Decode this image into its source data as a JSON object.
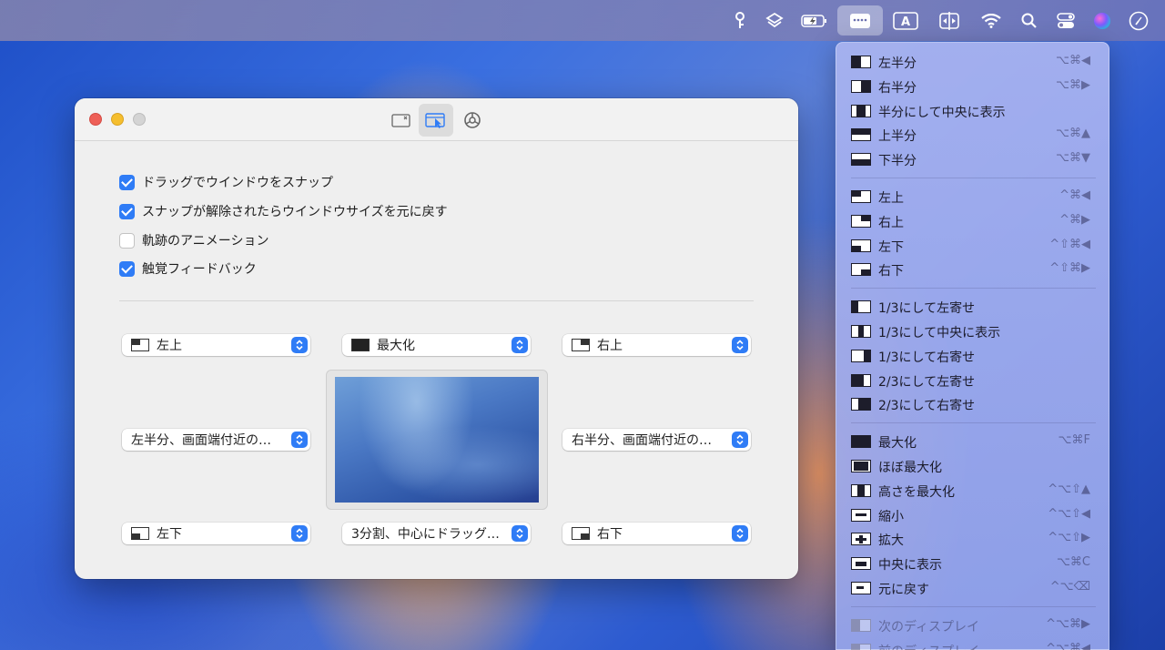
{
  "menubar": {
    "items": [
      {
        "name": "key-icon",
        "glyph": "⚿"
      },
      {
        "name": "layers-icon",
        "glyph": "◈"
      },
      {
        "name": "battery-icon",
        "glyph": ""
      },
      {
        "name": "window-manager-icon",
        "glyph": ""
      },
      {
        "name": "input-source-icon",
        "glyph": "A"
      },
      {
        "name": "split-view-icon",
        "glyph": ""
      },
      {
        "name": "wifi-icon",
        "glyph": ""
      },
      {
        "name": "search-icon",
        "glyph": ""
      },
      {
        "name": "control-center-icon",
        "glyph": ""
      },
      {
        "name": "siri-icon",
        "glyph": ""
      },
      {
        "name": "clock-icon",
        "glyph": ""
      }
    ]
  },
  "window": {
    "checkboxes": [
      {
        "label": "ドラッグでウインドウをスナップ",
        "checked": true
      },
      {
        "label": "スナップが解除されたらウインドウサイズを元に戻す",
        "checked": true
      },
      {
        "label": "軌跡のアニメーション",
        "checked": false
      },
      {
        "label": "触覚フィードバック",
        "checked": true
      }
    ],
    "selects": {
      "top_left": "左上",
      "top_center": "最大化",
      "top_right": "右上",
      "middle_left": "左半分、画面端付近の…",
      "middle_right": "右半分、画面端付近の…",
      "bottom_left": "左下",
      "bottom_center": "3分割、中心にドラッグ…",
      "bottom_right": "右下"
    }
  },
  "menu": {
    "groups": [
      [
        {
          "label": "左半分",
          "shortcut": "⌥⌘◀",
          "icon": "left-half"
        },
        {
          "label": "右半分",
          "shortcut": "⌥⌘▶",
          "icon": "right-half"
        },
        {
          "label": "半分にして中央に表示",
          "shortcut": "",
          "icon": "center-half"
        },
        {
          "label": "上半分",
          "shortcut": "⌥⌘▲",
          "icon": "top-half"
        },
        {
          "label": "下半分",
          "shortcut": "⌥⌘▼",
          "icon": "bottom-half"
        }
      ],
      [
        {
          "label": "左上",
          "shortcut": "^⌘◀",
          "icon": "top-left"
        },
        {
          "label": "右上",
          "shortcut": "^⌘▶",
          "icon": "top-right"
        },
        {
          "label": "左下",
          "shortcut": "^⇧⌘◀",
          "icon": "bottom-left"
        },
        {
          "label": "右下",
          "shortcut": "^⇧⌘▶",
          "icon": "bottom-right"
        }
      ],
      [
        {
          "label": "1/3にして左寄せ",
          "shortcut": "",
          "icon": "first-third"
        },
        {
          "label": "1/3にして中央に表示",
          "shortcut": "",
          "icon": "center-third"
        },
        {
          "label": "1/3にして右寄せ",
          "shortcut": "",
          "icon": "last-third"
        },
        {
          "label": "2/3にして左寄せ",
          "shortcut": "",
          "icon": "first-two-thirds"
        },
        {
          "label": "2/3にして右寄せ",
          "shortcut": "",
          "icon": "last-two-thirds"
        }
      ],
      [
        {
          "label": "最大化",
          "shortcut": "⌥⌘F",
          "icon": "maximize"
        },
        {
          "label": "ほぼ最大化",
          "shortcut": "",
          "icon": "almost-maximize"
        },
        {
          "label": "高さを最大化",
          "shortcut": "^⌥⇧▲",
          "icon": "maximize-height"
        },
        {
          "label": "縮小",
          "shortcut": "^⌥⇧◀",
          "icon": "smaller"
        },
        {
          "label": "拡大",
          "shortcut": "^⌥⇧▶",
          "icon": "larger"
        },
        {
          "label": "中央に表示",
          "shortcut": "⌥⌘C",
          "icon": "center"
        },
        {
          "label": "元に戻す",
          "shortcut": "^⌥⌫",
          "icon": "restore"
        }
      ],
      [
        {
          "label": "次のディスプレイ",
          "shortcut": "^⌥⌘▶",
          "icon": "next-display",
          "disabled": true
        },
        {
          "label": "前のディスプレイ",
          "shortcut": "^⌥⌘◀",
          "icon": "previous-display",
          "disabled": true
        }
      ]
    ]
  }
}
